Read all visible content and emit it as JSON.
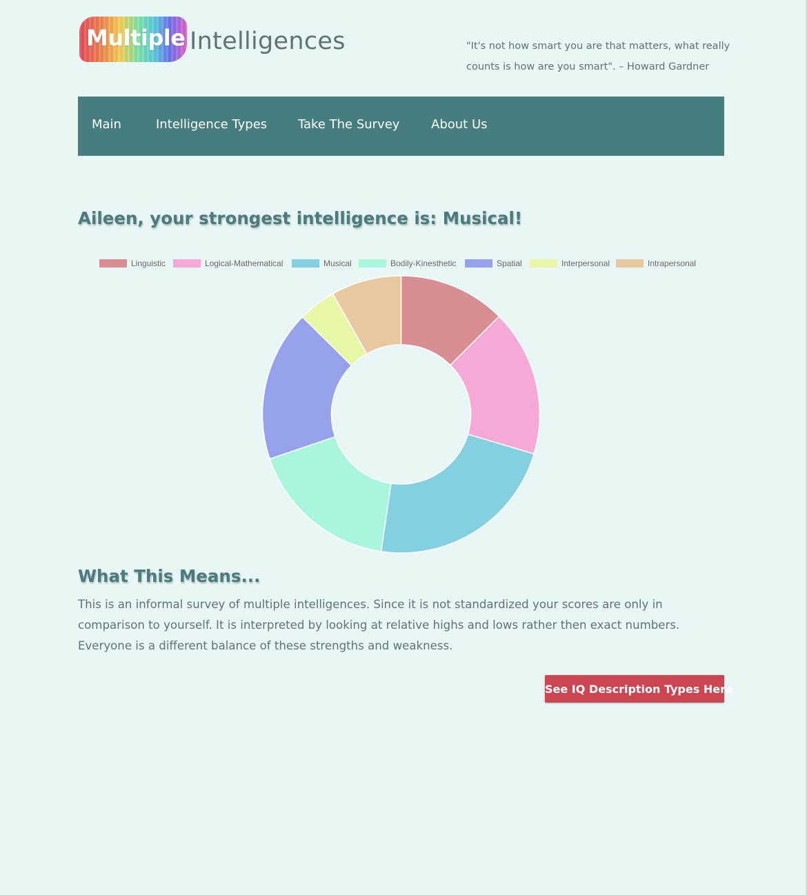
{
  "header": {
    "logo_word1": "Multiple",
    "logo_word2": "Intelligences",
    "quote": "\"It's not how smart you are that matters, what really counts is how are you smart\". – Howard Gardner"
  },
  "nav": {
    "items": [
      "Main",
      "Intelligence Types",
      "Take The Survey",
      "About Us"
    ]
  },
  "result": {
    "heading": "Aileen, your strongest intelligence is: Musical!"
  },
  "chart_data": {
    "type": "doughnut",
    "legend_position": "top",
    "categories": [
      "Linguistic",
      "Logical-Mathematical",
      "Musical",
      "Bodily-Kinesthetic",
      "Spatial",
      "Interpersonal",
      "Intrapersonal"
    ],
    "values": [
      12.5,
      17.1,
      22.7,
      17.5,
      17.6,
      4.4,
      8.2
    ],
    "colors": [
      "#d88d92",
      "#f5a9d4",
      "#83d1e0",
      "#a8f6dc",
      "#96a1ec",
      "#e6f8a6",
      "#e8c89e"
    ]
  },
  "meaning": {
    "heading": "What This Means...",
    "body": "This is an informal survey of multiple intelligences. Since it is not standardized your scores are only in comparison to yourself. It is interpreted by looking at relative highs and lows rather then exact numbers. Everyone is a different balance of these strengths and weakness."
  },
  "cta": {
    "label": "See IQ Description Types Here"
  },
  "colors": {
    "background": "#e8f6f6",
    "nav": "#467d7e",
    "heading": "#4d7a7b",
    "button": "#cc4651"
  }
}
